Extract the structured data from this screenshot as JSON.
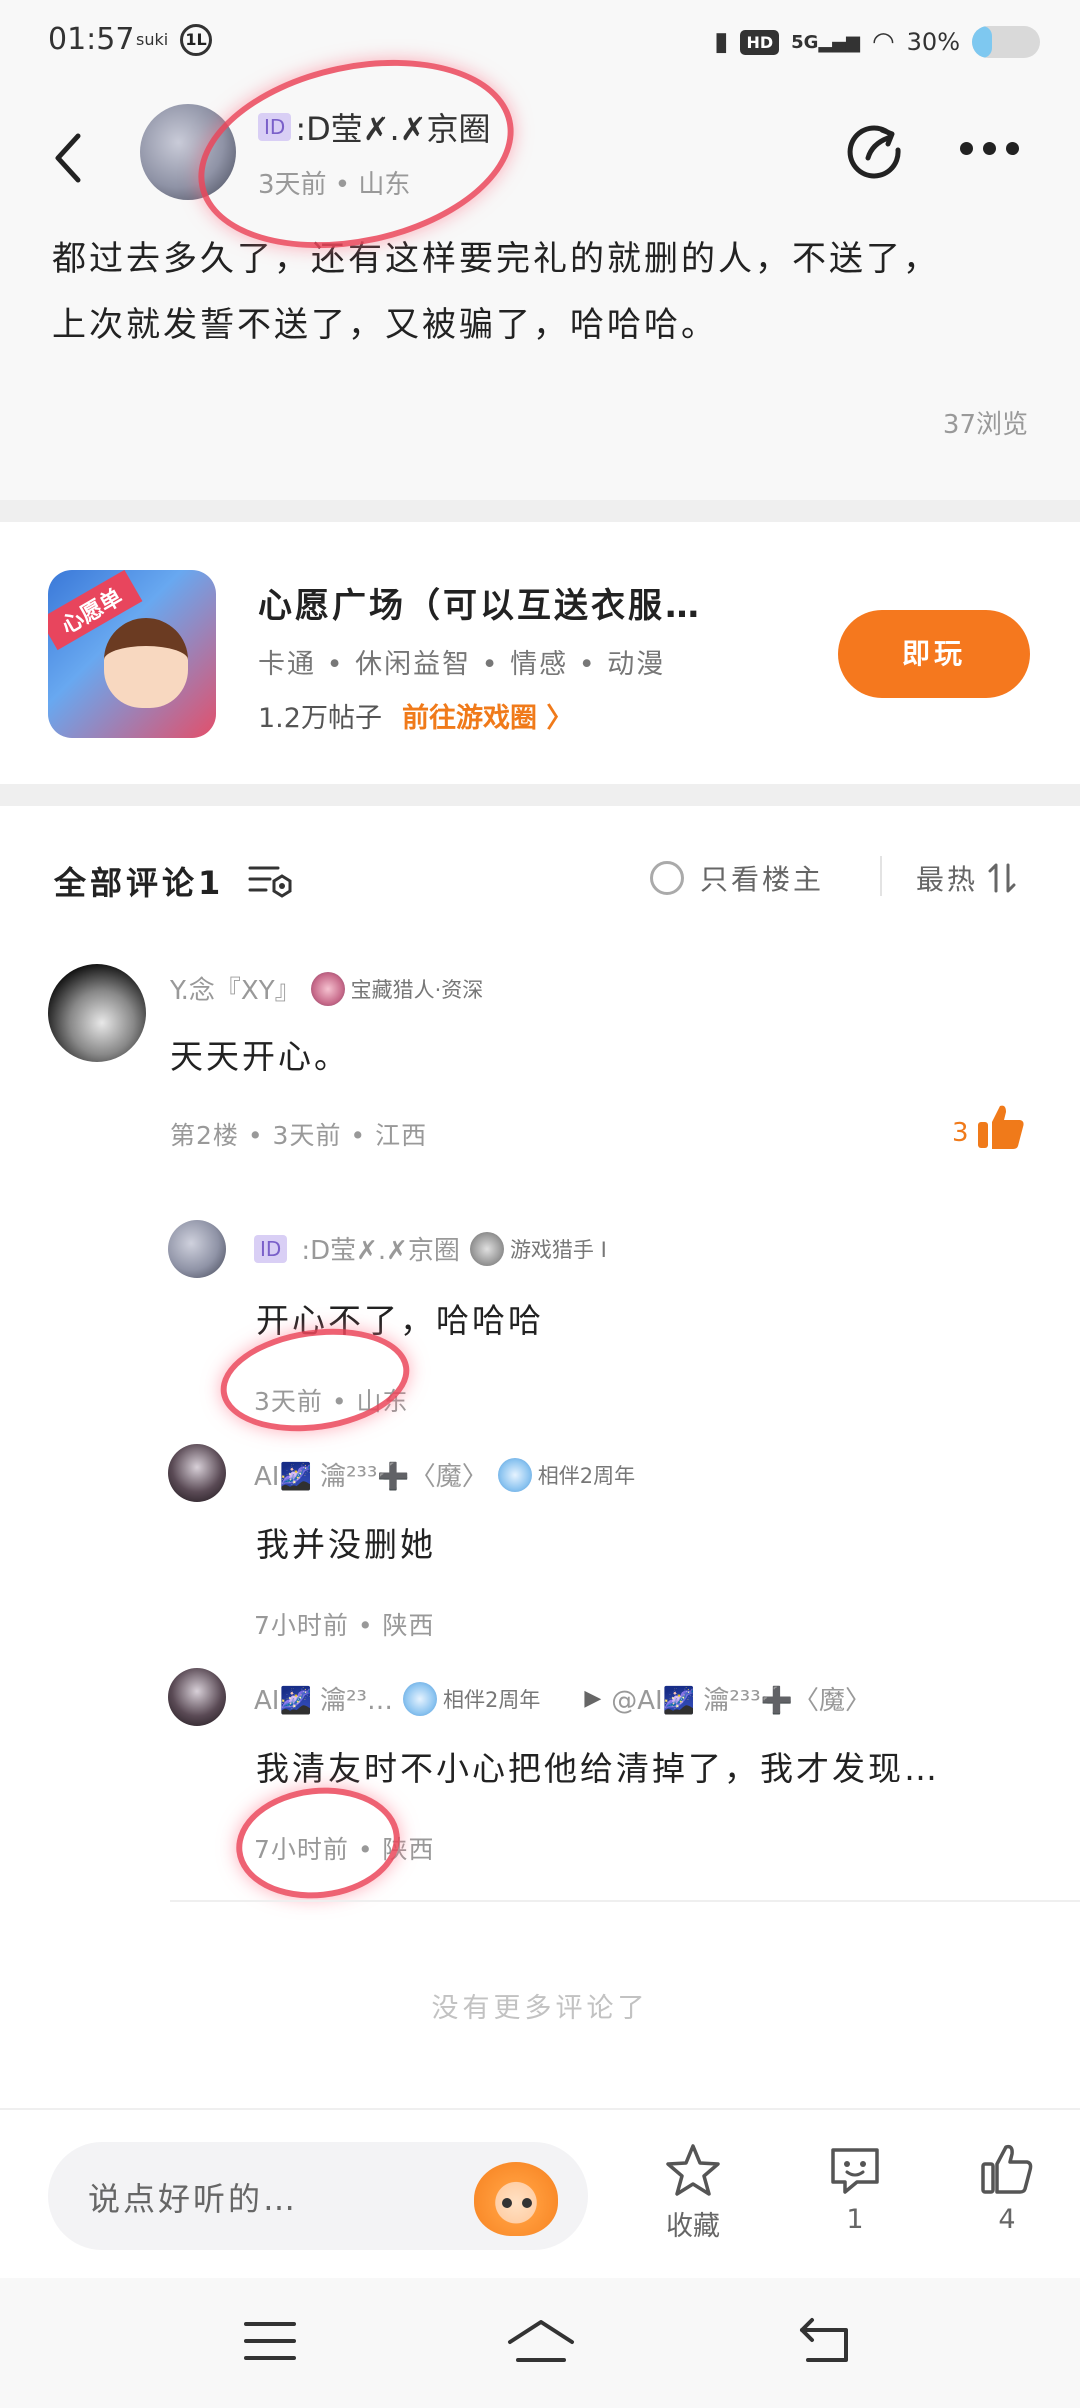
{
  "status_bar": {
    "time": "01:57",
    "carrier_label": "suki",
    "badge": "1L",
    "network": "5G",
    "hd": "HD",
    "battery_text": "30%",
    "battery_level": 0.3
  },
  "post": {
    "author_id_tag": "ID",
    "author_name": ":D莹✗.✗京圈",
    "meta": "3天前 • 山东",
    "content_line1": "都过去多久了，还有这样要完礼的就删的人，不送了，",
    "content_line2": "上次就发誓不送了，又被骗了，哈哈哈。",
    "views": "37浏览"
  },
  "game": {
    "icon_label": "心愿单",
    "title": "心愿广场（可以互送衣服…",
    "tags": "卡通 • 休闲益智 • 情感 • 动漫",
    "posts": "1.2万帖子",
    "link": "前往游戏圈 〉",
    "play_label": "即玩"
  },
  "comments_header": {
    "title": "全部评论1",
    "only_op": "只看楼主",
    "sort": "最热"
  },
  "comments": [
    {
      "name": "Y.念『XY』",
      "badge": "宝藏猎人·资深",
      "text": "天天开心。",
      "meta": "第2楼 • 3天前 • 江西",
      "likes": "3"
    }
  ],
  "replies": [
    {
      "id_tag": "ID",
      "name": ":D莹✗.✗京圈",
      "badge": "游戏猎手 I",
      "text": "开心不了，哈哈哈",
      "meta": "3天前 • 山东"
    },
    {
      "name": "AI🌌 瀹²³³➕〈魔〉",
      "badge": "相伴2周年",
      "text": "我并没删她",
      "meta": "7小时前 • 陕西"
    },
    {
      "name": "AI🌌 瀹²³…",
      "badge": "相伴2周年",
      "reply_to": "@AI🌌 瀹²³³➕〈魔〉",
      "text": "我清友时不小心把他给清掉了，我才发现…",
      "meta": "7小时前 • 陕西"
    }
  ],
  "no_more": "没有更多评论了",
  "bottom_bar": {
    "input_placeholder": "说点好听的…",
    "favorite_label": "收藏",
    "comment_count": "1",
    "like_count": "4"
  },
  "colors": {
    "accent_orange": "#f5781e",
    "link_orange": "#f07a1a",
    "annotation_red": "#eb465a"
  }
}
